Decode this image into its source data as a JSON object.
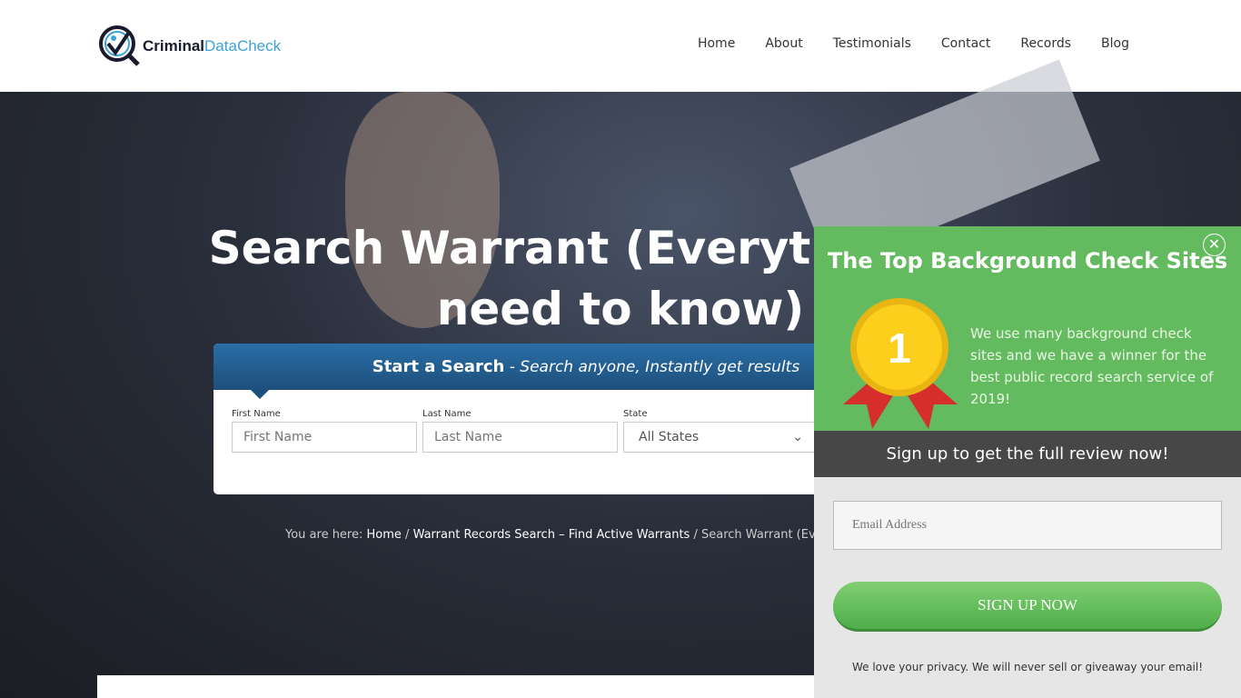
{
  "header": {
    "logo": {
      "part1": "Criminal",
      "part2": "DataCheck"
    },
    "nav": [
      "Home",
      "About",
      "Testimonials",
      "Contact",
      "Records",
      "Blog"
    ]
  },
  "hero": {
    "title": "Search Warrant (Everything you need to know)"
  },
  "search": {
    "heading_bold": "Start a Search",
    "heading_italic": " - Search anyone, Instantly get results",
    "first_label": "First Name",
    "first_placeholder": "First Name",
    "last_label": "Last Name",
    "last_placeholder": "Last Name",
    "state_label": "State",
    "state_value": "All States"
  },
  "breadcrumb": {
    "prefix": "You are here: ",
    "home": "Home",
    "sep": " / ",
    "parent": "Warrant Records Search – Find Active Warrants",
    "current": "Search Warrant (Everything you need to know)"
  },
  "popup": {
    "title": "The Top Background Check Sites",
    "medal_number": "1",
    "description": "We use many background check sites and we have a winner for the best public record search service of 2019!",
    "bar": "Sign up to get the full review now!",
    "email_placeholder": "Email Address",
    "button": "SIGN UP NOW",
    "privacy": "We love your privacy.  We will never sell or giveaway your email!",
    "colors": {
      "green": "#64bb5f",
      "dark": "#474747"
    }
  }
}
